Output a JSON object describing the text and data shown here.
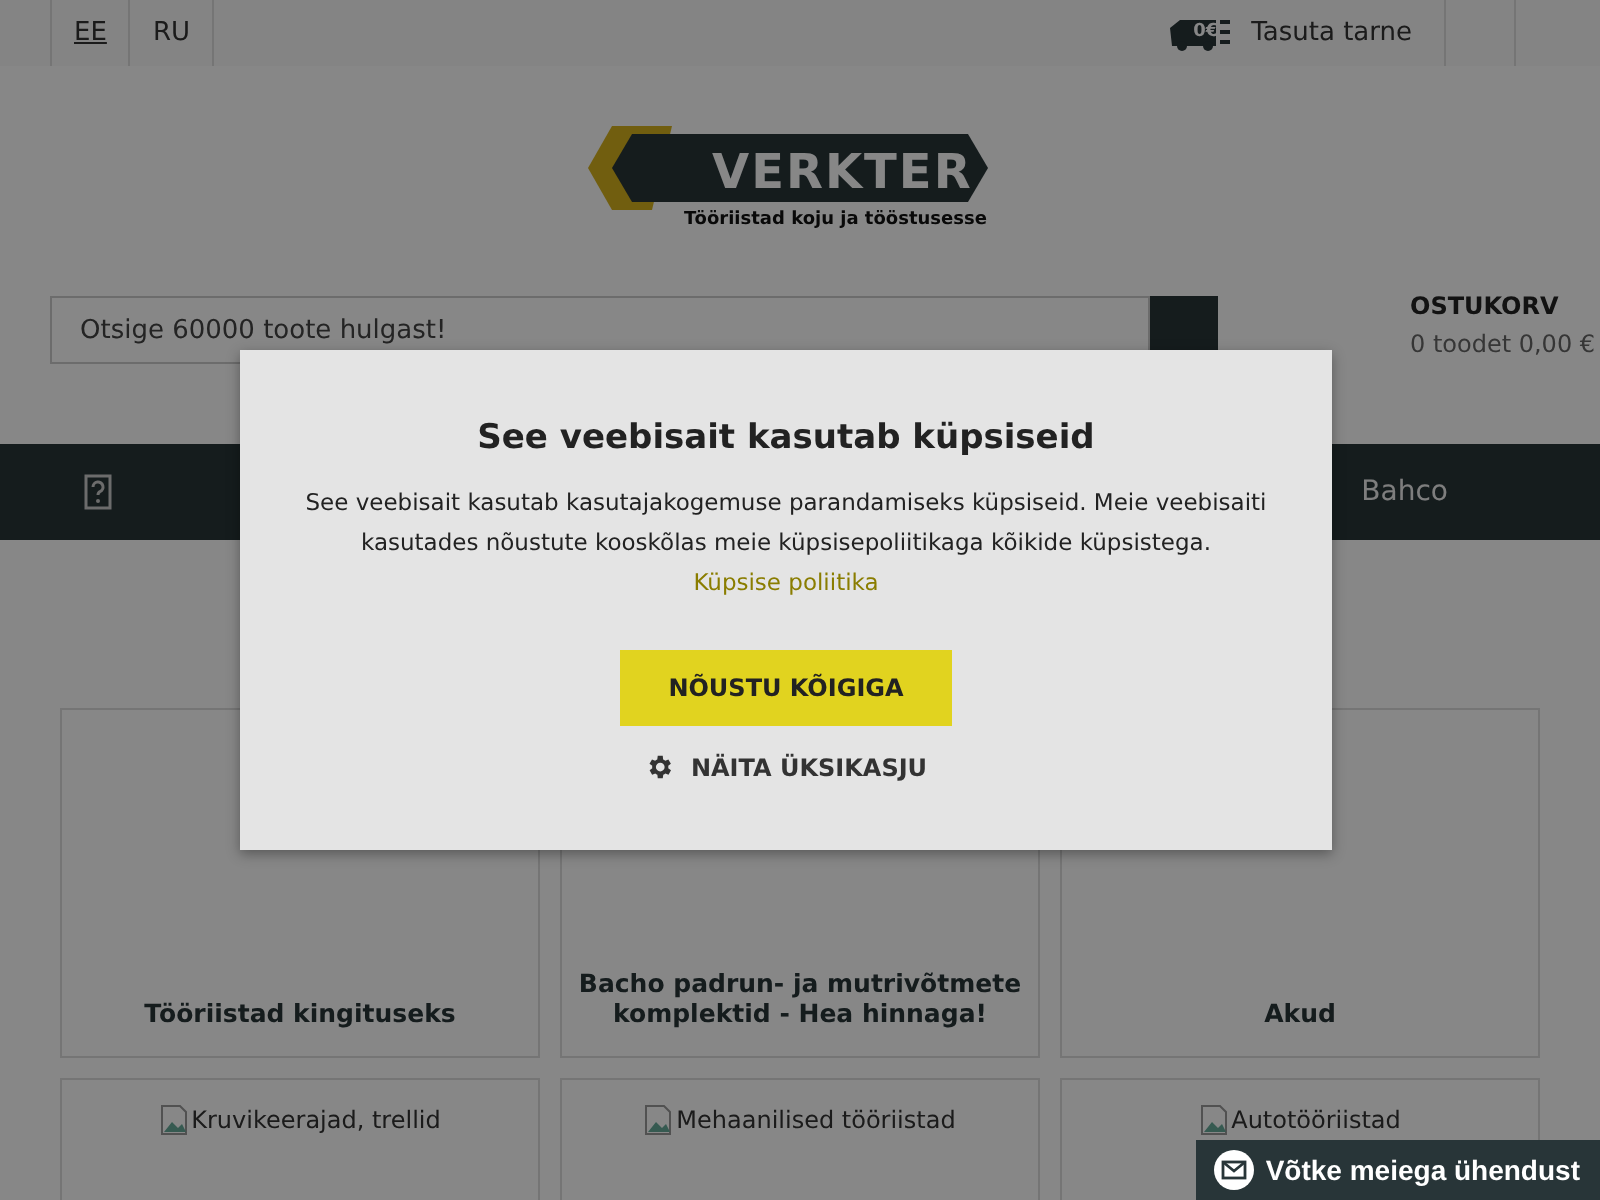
{
  "top_bar": {
    "languages": [
      {
        "label": "EE",
        "selected": true
      },
      {
        "label": "RU",
        "selected": false
      }
    ],
    "shipping": "Tasuta tarne",
    "shipping_badge": "0€"
  },
  "logo": {
    "name": "VERKTER",
    "tagline": "Tööriistad koju ja tööstusesse"
  },
  "search": {
    "placeholder": "Otsige 60000 toote hulgast!"
  },
  "cart": {
    "title": "OSTUKORV",
    "summary": "0 toodet 0,00 €"
  },
  "nav": {
    "items": [
      "Bahco"
    ]
  },
  "categories": [
    {
      "title": "Tööriistad kingituseks"
    },
    {
      "title": "Bacho padrun- ja mutrivõtmete komplektid - Hea hinnaga!"
    },
    {
      "title": "Akud"
    },
    {
      "image_alt": "Kruvikeerajad, trellid"
    },
    {
      "image_alt": "Mehaanilised tööriistad"
    },
    {
      "image_alt": "Autotööriistad"
    }
  ],
  "cookie_dialog": {
    "title": "See veebisait kasutab küpsiseid",
    "text": "See veebisait kasutab kasutajakogemuse parandamiseks küpsiseid. Meie veebisaiti kasutades nõustute kooskõlas meie küpsisepoliitikaga kõikide küpsistega.",
    "link": "Küpsise poliitika",
    "accept_button": "NÕUSTU KÕIGIGA",
    "details_button": "NÄITA ÜKSIKASJU"
  },
  "contact_button": "Võtke meiega ühendust"
}
